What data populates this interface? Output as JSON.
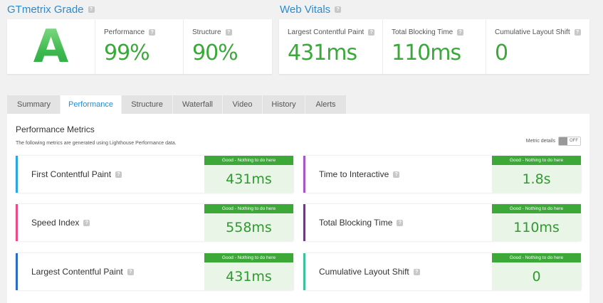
{
  "grade_section": {
    "title": "GTmetrix Grade",
    "grade": "A",
    "performance": {
      "label": "Performance",
      "value": "99%"
    },
    "structure": {
      "label": "Structure",
      "value": "90%"
    }
  },
  "vitals_section": {
    "title": "Web Vitals",
    "items": [
      {
        "label": "Largest Contentful Paint",
        "value": "431ms"
      },
      {
        "label": "Total Blocking Time",
        "value": "110ms"
      },
      {
        "label": "Cumulative Layout Shift",
        "value": "0"
      }
    ]
  },
  "tabs": [
    {
      "label": "Summary"
    },
    {
      "label": "Performance",
      "active": true
    },
    {
      "label": "Structure"
    },
    {
      "label": "Waterfall"
    },
    {
      "label": "Video"
    },
    {
      "label": "History"
    },
    {
      "label": "Alerts"
    }
  ],
  "panel": {
    "title": "Performance Metrics",
    "subtitle": "The following metrics are generated using Lighthouse Performance data.",
    "toggle_label": "Metric details",
    "toggle_state": "OFF"
  },
  "metrics": [
    {
      "name": "First Contentful Paint",
      "status": "Good - Nothing to do here",
      "value": "431ms",
      "color": "#2aa7e0"
    },
    {
      "name": "Time to Interactive",
      "status": "Good - Nothing to do here",
      "value": "1.8s",
      "color": "#a855c8"
    },
    {
      "name": "Speed Index",
      "status": "Good - Nothing to do here",
      "value": "558ms",
      "color": "#ea4c89"
    },
    {
      "name": "Total Blocking Time",
      "status": "Good - Nothing to do here",
      "value": "110ms",
      "color": "#6a3d7d"
    },
    {
      "name": "Largest Contentful Paint",
      "status": "Good - Nothing to do here",
      "value": "431ms",
      "color": "#2d6cc0"
    },
    {
      "name": "Cumulative Layout Shift",
      "status": "Good - Nothing to do here",
      "value": "0",
      "color": "#3cc19b"
    }
  ],
  "colors": {
    "accent_blue": "#2a8bd0",
    "good_green": "#3ba838",
    "good_green_bg": "#e9f6e7"
  },
  "icons": {
    "help": "question-mark-icon"
  }
}
